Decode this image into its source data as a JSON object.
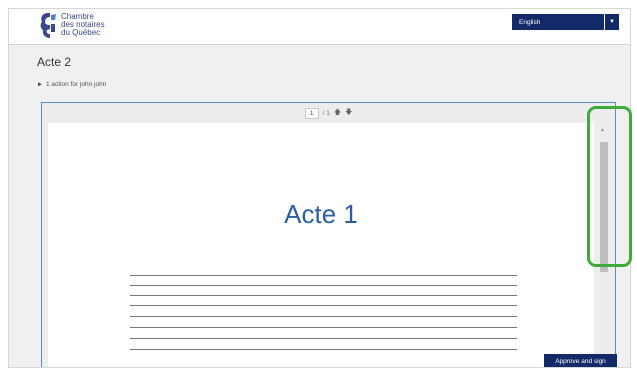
{
  "logo": {
    "lines": [
      "Chambre",
      "des notaires",
      "du Québec"
    ]
  },
  "language": {
    "selected": "English"
  },
  "page": {
    "title": "Acte 2"
  },
  "action": {
    "label": "1 action for john john"
  },
  "viewer": {
    "current_page": "1",
    "total_pages": "/ 1"
  },
  "document": {
    "heading": "Acte 1"
  },
  "footer": {
    "approve_label": "Approve and sign"
  },
  "colors": {
    "brand": "#142a68",
    "accent": "#2d5fa0",
    "highlight": "#3eaa3a"
  },
  "icons": [
    "logo-mark",
    "chevron-down-icon",
    "expand-triangle-icon",
    "arrow-up-icon",
    "arrow-down-icon",
    "scroll-up-icon"
  ]
}
